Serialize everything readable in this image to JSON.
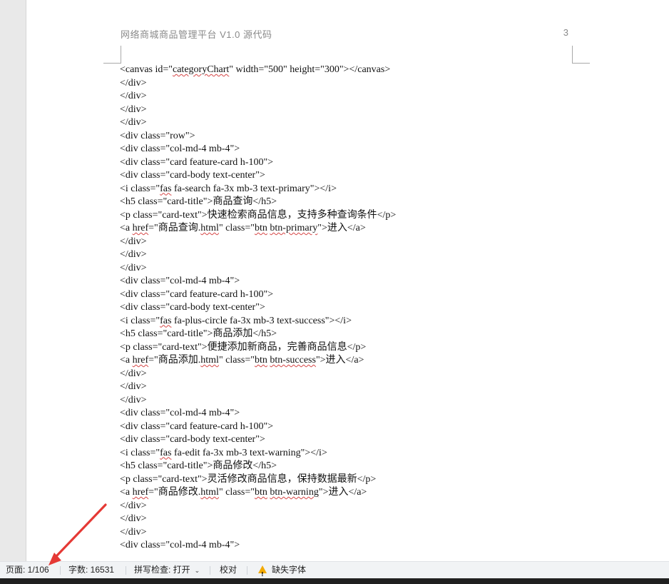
{
  "document": {
    "header_title": "网络商城商品管理平台 V1.0 源代码",
    "page_number": "3",
    "code_lines": [
      [
        "<canvas id=\"",
        {
          "t": "categoryChart",
          "s": true
        },
        "\" width=\"500\" height=\"300\"></canvas>"
      ],
      [
        "</div>"
      ],
      [
        "</div>"
      ],
      [
        "</div>"
      ],
      [
        "</div>"
      ],
      [
        "<div class=\"row\">"
      ],
      [
        "<div class=\"col-md-4 mb-4\">"
      ],
      [
        "<div class=\"card feature-card h-100\">"
      ],
      [
        "<div class=\"card-body text-center\">"
      ],
      [
        "<i class=\"",
        {
          "t": "fas",
          "s": true
        },
        " fa-search fa-3x mb-3 text-primary\"></i>"
      ],
      [
        "<h5 class=\"card-title\">商品查询</h5>"
      ],
      [
        "<p class=\"card-text\">快速检索商品信息，支持多种查询条件</p>"
      ],
      [
        "<a ",
        {
          "t": "href",
          "s": true
        },
        "=\"商品查询.",
        {
          "t": "html",
          "s": true
        },
        "\" class=\"",
        {
          "t": "btn",
          "s": true
        },
        " ",
        {
          "t": "btn-primary",
          "s": true
        },
        "\">进入</a>"
      ],
      [
        "</div>"
      ],
      [
        "</div>"
      ],
      [
        "</div>"
      ],
      [
        "<div class=\"col-md-4 mb-4\">"
      ],
      [
        "<div class=\"card feature-card h-100\">"
      ],
      [
        "<div class=\"card-body text-center\">"
      ],
      [
        "<i class=\"",
        {
          "t": "fas",
          "s": true
        },
        " fa-plus-circle fa-3x mb-3 text-success\"></i>"
      ],
      [
        "<h5 class=\"card-title\">商品添加</h5>"
      ],
      [
        "<p class=\"card-text\">便捷添加新商品，完善商品信息</p>"
      ],
      [
        "<a ",
        {
          "t": "href",
          "s": true
        },
        "=\"商品添加.",
        {
          "t": "html",
          "s": true
        },
        "\" class=\"",
        {
          "t": "btn",
          "s": true
        },
        " ",
        {
          "t": "btn-success",
          "s": true
        },
        "\">进入</a>"
      ],
      [
        "</div>"
      ],
      [
        "</div>"
      ],
      [
        "</div>"
      ],
      [
        "<div class=\"col-md-4 mb-4\">"
      ],
      [
        "<div class=\"card feature-card h-100\">"
      ],
      [
        "<div class=\"card-body text-center\">"
      ],
      [
        "<i class=\"",
        {
          "t": "fas",
          "s": true
        },
        " fa-edit fa-3x mb-3 text-warning\"></i>"
      ],
      [
        "<h5 class=\"card-title\">商品修改</h5>"
      ],
      [
        "<p class=\"card-text\">灵活修改商品信息，保持数据最新</p>"
      ],
      [
        "<a ",
        {
          "t": "href",
          "s": true
        },
        "=\"商品修改.",
        {
          "t": "html",
          "s": true
        },
        "\" class=\"",
        {
          "t": "btn",
          "s": true
        },
        " ",
        {
          "t": "btn-warning",
          "s": true
        },
        "\">进入</a>"
      ],
      [
        "</div>"
      ],
      [
        "</div>"
      ],
      [
        "</div>"
      ],
      [
        "<div class=\"col-md-4 mb-4\">"
      ]
    ]
  },
  "status_bar": {
    "page": "页面: 1/106",
    "word_count": "字数: 16531",
    "spell_check": "拼写检查: 打开",
    "proofread": "校对",
    "missing_fonts": "缺失字体"
  },
  "annotation": {
    "arrow_color": "#e53935"
  },
  "icons": {
    "missing_fonts_icon": "warning-icon",
    "spell_check_dropdown": "chevron-down-icon",
    "annotation_arrow": "red-arrow-icon"
  }
}
